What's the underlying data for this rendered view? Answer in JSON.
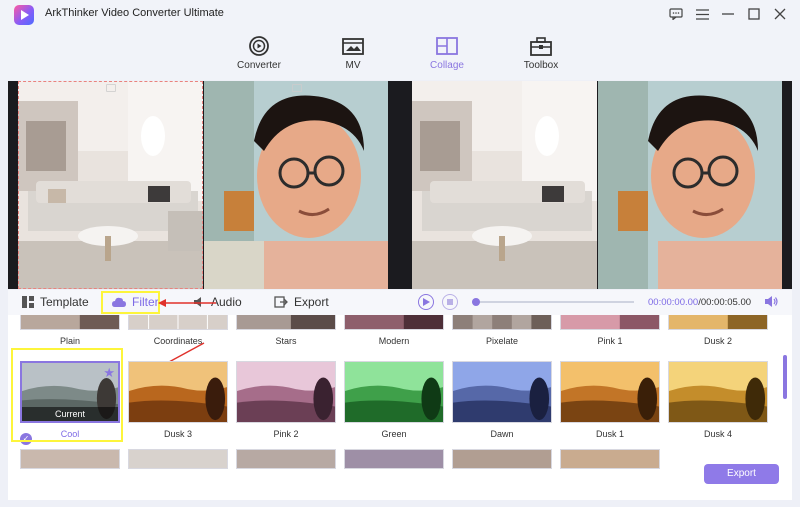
{
  "app": {
    "title": "ArkThinker Video Converter Ultimate"
  },
  "nav": {
    "tabs": [
      {
        "label": "Converter",
        "icon": "converter-icon"
      },
      {
        "label": "MV",
        "icon": "mv-icon"
      },
      {
        "label": "Collage",
        "icon": "collage-icon"
      },
      {
        "label": "Toolbox",
        "icon": "toolbox-icon"
      }
    ],
    "active": "Collage"
  },
  "tools": {
    "template": "Template",
    "filter": "Filter",
    "audio": "Audio",
    "export": "Export"
  },
  "player": {
    "current_time": "00:00:00.00",
    "separator": "/",
    "total_time": "00:00:05.00",
    "progress": 0
  },
  "filters": {
    "row1": [
      "Plain",
      "Coordinates",
      "Stars",
      "Modern",
      "Pixelate",
      "Pink 1",
      "Dusk 2"
    ],
    "row2": [
      "Cool",
      "Dusk 3",
      "Pink 2",
      "Green",
      "Dawn",
      "Dusk 1",
      "Dusk 4"
    ],
    "current_label": "Current",
    "selected": "Cool"
  },
  "export_button": "Export",
  "colors": {
    "accent": "#8a76e0",
    "highlight": "#fdf53b",
    "annotation": "#e0312b"
  }
}
